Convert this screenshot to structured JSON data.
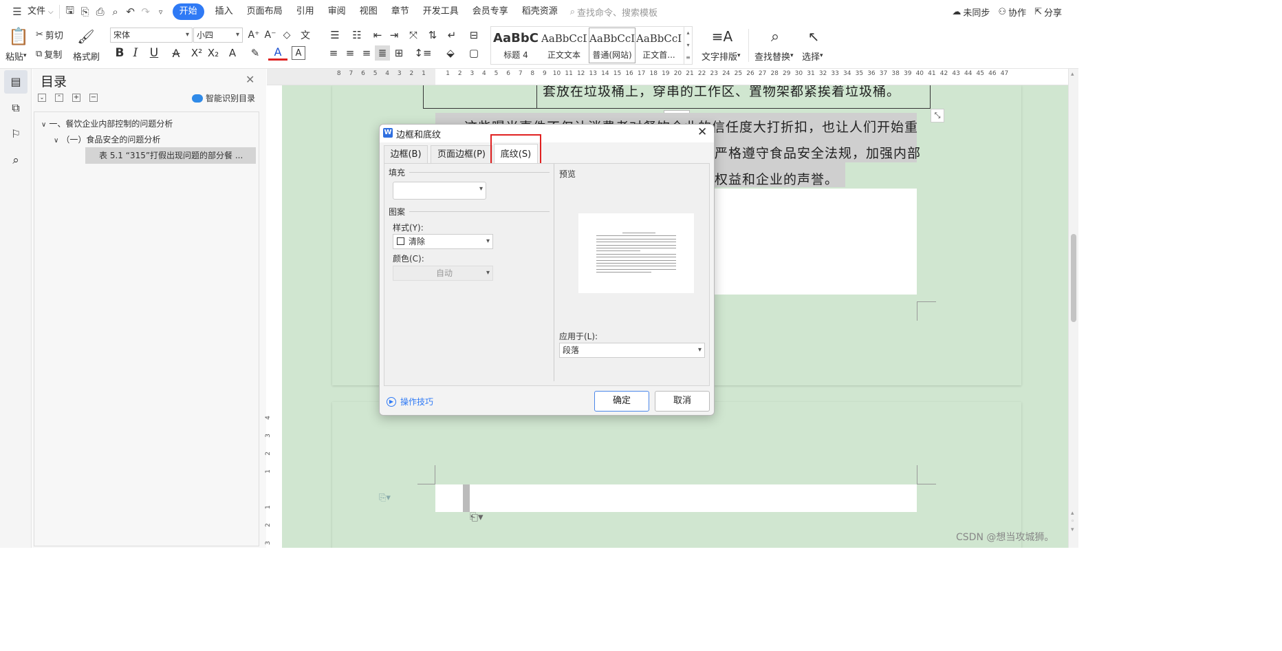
{
  "menubar": {
    "file": "文件",
    "tabs": [
      "开始",
      "插入",
      "页面布局",
      "引用",
      "审阅",
      "视图",
      "章节",
      "开发工具",
      "会员专享",
      "稻壳资源"
    ],
    "search_placeholder": "查找命令、搜索模板",
    "sync": "未同步",
    "collab": "协作",
    "share": "分享"
  },
  "ribbon": {
    "paste": "粘贴",
    "cut": "剪切",
    "copy": "复制",
    "format_painter": "格式刷",
    "font_name": "宋体",
    "font_size": "小四",
    "styles": [
      {
        "sample": "AaBbC",
        "name": "标题 4"
      },
      {
        "sample": "AaBbCcD",
        "name": "正文文本"
      },
      {
        "sample": "AaBbCcI",
        "name": "普通(网站)"
      },
      {
        "sample": "AaBbCcI",
        "name": "正文首..."
      }
    ],
    "text_layout": "文字排版",
    "find_replace": "查找替换",
    "select": "选择"
  },
  "toc": {
    "title": "目录",
    "smart": "智能识别目录",
    "items": [
      "一、餐饮企业内部控制的问题分析",
      "（一）食品安全的问题分析",
      "表 5.1 “315”打假出现问题的部分餐 ..."
    ]
  },
  "ruler": {
    "marks": [
      "8",
      "7",
      "6",
      "5",
      "4",
      "3",
      "2",
      "1",
      "",
      "1",
      "2",
      "3",
      "4",
      "5",
      "6",
      "7",
      "8",
      "9",
      "10",
      "11",
      "12",
      "13",
      "14",
      "15",
      "16",
      "17",
      "18",
      "19",
      "20",
      "21",
      "22",
      "23",
      "24",
      "25",
      "26",
      "27",
      "28",
      "29",
      "30",
      "31",
      "32",
      "33",
      "34",
      "35",
      "36",
      "37",
      "38",
      "39",
      "40",
      "41",
      "42",
      "43",
      "44",
      "45",
      "46",
      "47"
    ],
    "vmarks": [
      "4",
      "3",
      "2",
      "1",
      "",
      "1",
      "2",
      "3"
    ]
  },
  "document": {
    "line0": "套放在垃圾桶上，穿串的工作区、置物架都紧挨着垃圾桶。",
    "line1a": "这些曝光事件不仅让消费者对餐饮企业的信任度大打折扣，也让人们开始重",
    "line2a": "严格遵守食品安全法规，加强内部",
    "line3a": "权益和企业的声誉。"
  },
  "dialog": {
    "title": "边框和底纹",
    "tabs": [
      "边框(B)",
      "页面边框(P)",
      "底纹(S)"
    ],
    "fill_label": "填充",
    "fill_value": "",
    "pattern_label": "图案",
    "style_label": "样式(Y):",
    "style_value": "清除",
    "color_label": "颜色(C):",
    "color_value": "自动",
    "preview_label": "预览",
    "apply_label": "应用于(L):",
    "apply_value": "段落",
    "tips": "操作技巧",
    "ok": "确定",
    "cancel": "取消"
  },
  "watermark": "CSDN @想当攻城狮。",
  "colors": {
    "accent": "#2f7af5",
    "highlight_red": "#e02020",
    "doc_bg": "#d0e6d0"
  }
}
